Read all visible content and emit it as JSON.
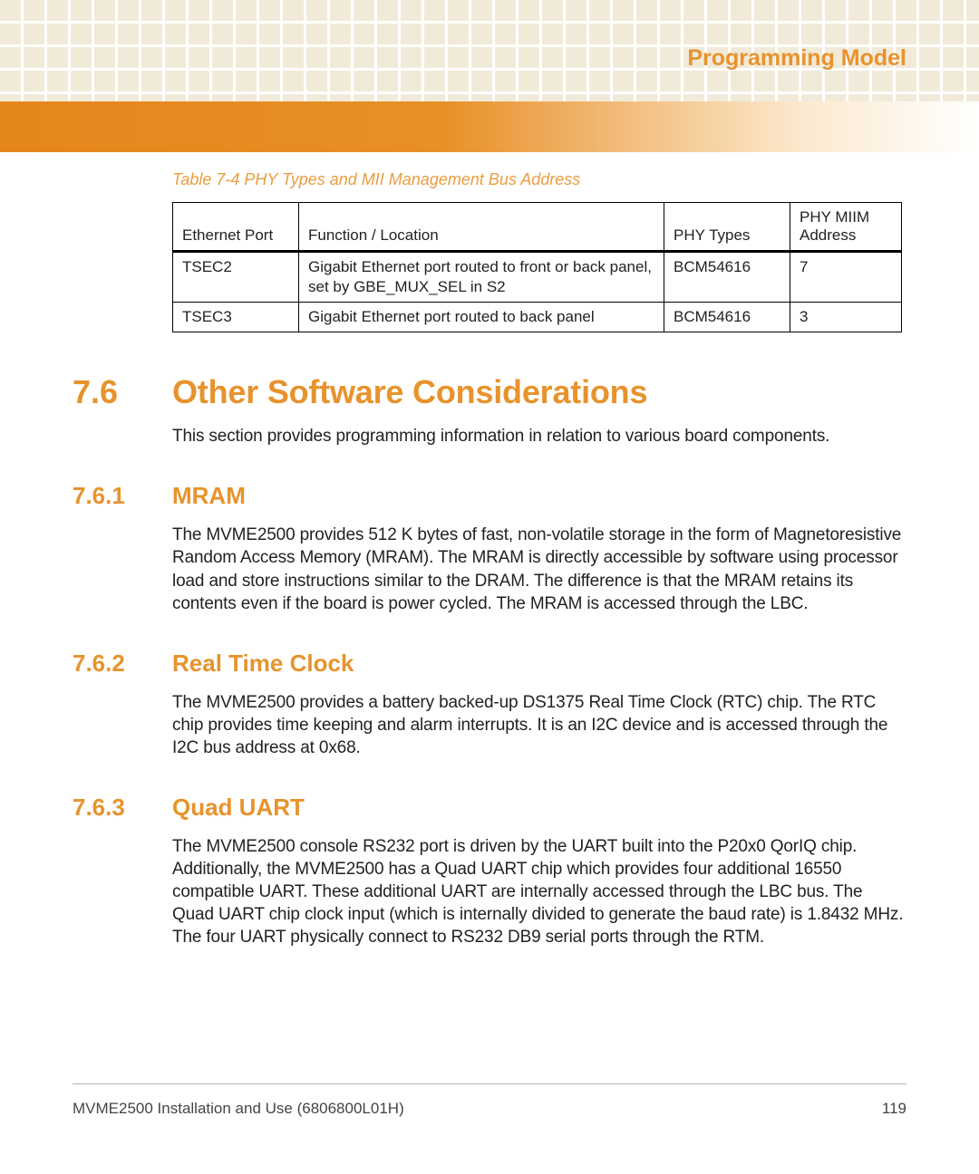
{
  "chapter": "Programming Model",
  "tableCaption": "Table 7-4 PHY Types and MII Management Bus Address",
  "table": {
    "headers": [
      "Ethernet Port",
      "Function / Location",
      "PHY Types",
      "PHY MIIM Address"
    ],
    "rows": [
      {
        "port": "TSEC2",
        "func": "Gigabit Ethernet port routed to front or back panel, set by GBE_MUX_SEL in S2",
        "type": "BCM54616",
        "addr": "7"
      },
      {
        "port": "TSEC3",
        "func": "Gigabit Ethernet port routed to back panel",
        "type": "BCM54616",
        "addr": "3"
      }
    ]
  },
  "section": {
    "num": "7.6",
    "title": "Other Software Considerations",
    "intro": "This section provides programming information in relation to various board components."
  },
  "sub1": {
    "num": "7.6.1",
    "title": "MRAM",
    "body": "The MVME2500 provides 512 K bytes of fast, non-volatile storage in the form of Magnetoresistive Random Access Memory (MRAM). The MRAM is directly accessible by software using processor load and store instructions similar to the DRAM. The difference is that the MRAM retains its contents even if the board is power cycled. The MRAM is accessed through the LBC."
  },
  "sub2": {
    "num": "7.6.2",
    "title": "Real Time Clock",
    "body": "The MVME2500 provides a battery backed-up DS1375 Real Time Clock (RTC) chip. The RTC chip provides time keeping and alarm interrupts. It is an I2C device and is accessed through the I2C bus address at 0x68."
  },
  "sub3": {
    "num": "7.6.3",
    "title": "Quad UART",
    "body": "The MVME2500 console RS232 port is driven by the UART built into the P20x0 QorIQ chip. Additionally, the MVME2500 has a Quad UART chip which provides four additional 16550 compatible UART. These additional UART are internally accessed through the LBC bus. The Quad UART chip clock input (which is internally divided to generate the baud rate) is 1.8432 MHz. The four UART physically connect to RS232 DB9 serial ports through the RTM."
  },
  "footer": {
    "left": "MVME2500 Installation and Use (6806800L01H)",
    "right": "119"
  }
}
